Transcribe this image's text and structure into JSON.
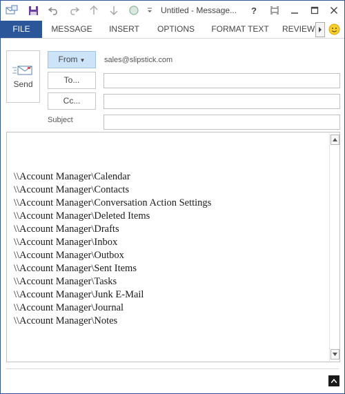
{
  "window": {
    "title": "Untitled - Message..."
  },
  "quick_access": [
    {
      "icon": "send-receive-icon"
    },
    {
      "icon": "save-icon"
    },
    {
      "icon": "undo-icon"
    },
    {
      "icon": "redo-icon"
    },
    {
      "icon": "up-arrow-icon"
    },
    {
      "icon": "down-arrow-icon"
    },
    {
      "icon": "circle-icon"
    },
    {
      "icon": "customize-dropdown-icon"
    }
  ],
  "window_controls": {
    "help": "?",
    "restore_icon": "ribbon-display-icon",
    "minimize_icon": "minimize-icon",
    "maximize_icon": "maximize-icon",
    "close_icon": "close-icon"
  },
  "ribbon": {
    "tabs": [
      "FILE",
      "MESSAGE",
      "INSERT",
      "OPTIONS",
      "FORMAT TEXT",
      "REVIEW"
    ],
    "accent_color": "#2b579a"
  },
  "compose": {
    "send_label": "Send",
    "from_label": "From",
    "from_value": "sales@slipstick.com",
    "to_label": "To...",
    "cc_label": "Cc...",
    "subject_label": "Subject",
    "to_value": "",
    "cc_value": "",
    "subject_value": ""
  },
  "body": {
    "lines": [
      "\\\\Account Manager\\Calendar",
      "\\\\Account Manager\\Contacts",
      "\\\\Account Manager\\Conversation Action Settings",
      "\\\\Account Manager\\Deleted Items",
      "\\\\Account Manager\\Drafts",
      "\\\\Account Manager\\Inbox",
      "\\\\Account Manager\\Outbox",
      "\\\\Account Manager\\Sent Items",
      "\\\\Account Manager\\Tasks",
      "\\\\Account Manager\\Junk E-Mail",
      "\\\\Account Manager\\Journal",
      "\\\\Account Manager\\Notes"
    ]
  }
}
